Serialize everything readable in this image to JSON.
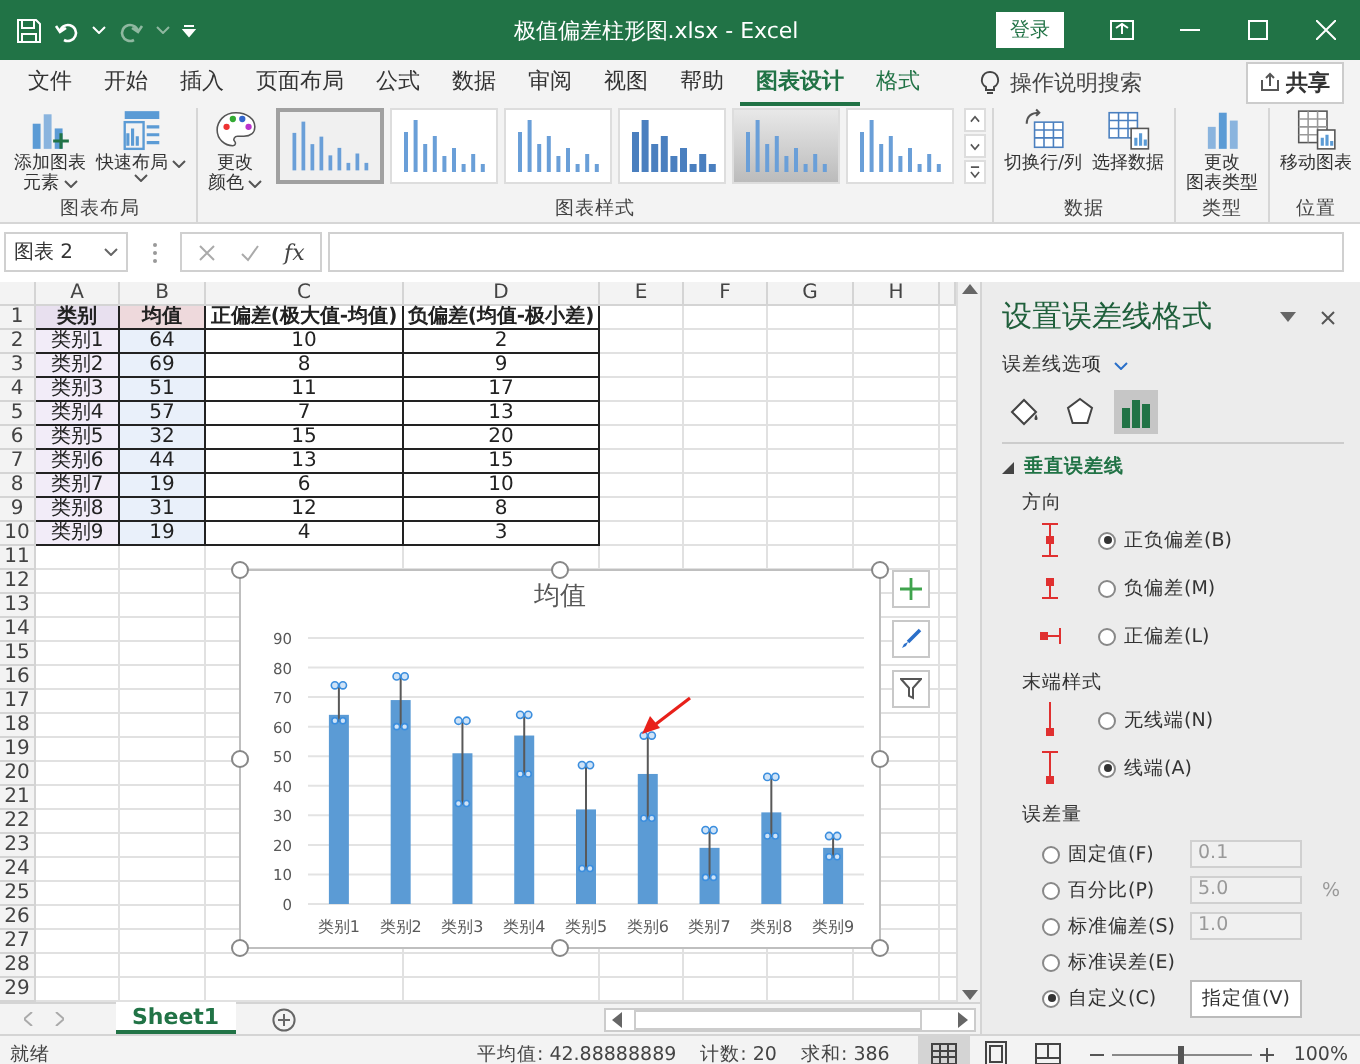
{
  "window": {
    "title": "极值偏差柱形图.xlsx  -  Excel",
    "login": "登录"
  },
  "ribbon": {
    "tabs": [
      {
        "label": "文件",
        "selected": false
      },
      {
        "label": "开始",
        "selected": false
      },
      {
        "label": "插入",
        "selected": false
      },
      {
        "label": "页面布局",
        "selected": false
      },
      {
        "label": "公式",
        "selected": false
      },
      {
        "label": "数据",
        "selected": false
      },
      {
        "label": "审阅",
        "selected": false
      },
      {
        "label": "视图",
        "selected": false
      },
      {
        "label": "帮助",
        "selected": false
      },
      {
        "label": "图表设计",
        "selected": true
      },
      {
        "label": "格式",
        "selected": false
      }
    ],
    "search": "操作说明搜索",
    "share": "共享",
    "groups": [
      {
        "label": "图表布局",
        "buttons": [
          {
            "kind": "add-element",
            "label": [
              "添加图表",
              "元素"
            ],
            "menu": true
          },
          {
            "kind": "quick-layout",
            "label": [
              "快速布局"
            ],
            "menu": true
          }
        ]
      },
      {
        "label": "图表样式",
        "buttons": [
          {
            "kind": "colors",
            "label": [
              "更改",
              "颜色"
            ],
            "menu": true
          }
        ],
        "styles": [
          {
            "selected": true
          },
          {
            "selected": false
          },
          {
            "selected": false
          },
          {
            "selected": false
          },
          {
            "selected": false
          },
          {
            "selected": false
          }
        ]
      },
      {
        "label": "数据",
        "buttons": [
          {
            "kind": "switch",
            "label": [
              "切换行/列"
            ],
            "menu": false
          },
          {
            "kind": "select-data",
            "label": [
              "选择数据"
            ],
            "menu": false
          }
        ]
      },
      {
        "label": "类型",
        "buttons": [
          {
            "kind": "change-type",
            "label": [
              "更改",
              "图表类型"
            ],
            "menu": false
          }
        ]
      },
      {
        "label": "位置",
        "buttons": [
          {
            "kind": "move",
            "label": [
              "移动图表"
            ],
            "menu": false
          }
        ]
      }
    ]
  },
  "formula_bar": {
    "name_box": "图表 2",
    "function_label": "fx"
  },
  "sheet": {
    "column_headers": [
      "A",
      "B",
      "C",
      "D",
      "E",
      "F",
      "G",
      "H"
    ],
    "row_numbers": [
      "1",
      "2",
      "3",
      "4",
      "5",
      "6",
      "7",
      "8",
      "9",
      "10",
      "11",
      "12",
      "13",
      "14",
      "15",
      "16",
      "17",
      "18",
      "19",
      "20",
      "21",
      "22",
      "23",
      "24",
      "25",
      "26",
      "27",
      "28",
      "29"
    ],
    "header": [
      "类别",
      "均值",
      "正偏差(极大值-均值)",
      "负偏差(均值-极小差)"
    ],
    "rows": [
      [
        "类别1",
        "64",
        "10",
        "2"
      ],
      [
        "类别2",
        "69",
        "8",
        "9"
      ],
      [
        "类别3",
        "51",
        "11",
        "17"
      ],
      [
        "类别4",
        "57",
        "7",
        "13"
      ],
      [
        "类别5",
        "32",
        "15",
        "20"
      ],
      [
        "类别6",
        "44",
        "13",
        "15"
      ],
      [
        "类别7",
        "19",
        "6",
        "10"
      ],
      [
        "类别8",
        "31",
        "12",
        "8"
      ],
      [
        "类别9",
        "19",
        "4",
        "3"
      ]
    ],
    "chart": {
      "chart_data": {
        "type": "bar",
        "grid": true,
        "title": "均值",
        "categories": [
          "类别1",
          "类别2",
          "类别3",
          "类别4",
          "类别5",
          "类别6",
          "类别7",
          "类别8",
          "类别9"
        ],
        "values": [
          64,
          69,
          51,
          57,
          32,
          44,
          19,
          31,
          19
        ],
        "ylim": [
          0,
          90
        ],
        "yticks": [
          0,
          10,
          20,
          30,
          40,
          50,
          60,
          70,
          80,
          90
        ]
      }
    }
  },
  "sheet_tabs": [
    {
      "label": "Sheet1",
      "selected": true
    }
  ],
  "pane": {
    "title": "设置误差线格式",
    "options_label": "误差线选项",
    "tabs": [
      {
        "kind": "fill",
        "selected": false
      },
      {
        "kind": "effects",
        "selected": false
      },
      {
        "kind": "options",
        "selected": true
      }
    ],
    "section": {
      "label": "垂直误差线",
      "expanded": true
    },
    "direction": {
      "label": "方向",
      "options": [
        {
          "kind": "both",
          "label": "正负偏差(B)",
          "selected": true
        },
        {
          "kind": "minus",
          "label": "负偏差(M)",
          "selected": false
        },
        {
          "kind": "plus",
          "label": "正偏差(L)",
          "selected": false
        }
      ]
    },
    "end_style": {
      "label": "末端样式",
      "options": [
        {
          "kind": "no-cap",
          "label": "无线端(N)",
          "selected": false
        },
        {
          "kind": "cap",
          "label": "线端(A)",
          "selected": true
        }
      ]
    },
    "amount": {
      "label": "误差量",
      "options": [
        {
          "label": "固定值(F)",
          "selected": false,
          "value": "0.1"
        },
        {
          "label": "百分比(P)",
          "selected": false,
          "value": "5.0",
          "unit": "%"
        },
        {
          "label": "标准偏差(S)",
          "selected": false,
          "value": "1.0"
        },
        {
          "label": "标准误差(E)",
          "selected": false
        },
        {
          "label": "自定义(C)",
          "selected": true,
          "button": "指定值(V)"
        }
      ]
    }
  },
  "status_bar": {
    "status": "就绪",
    "average": "平均值: 42.88888889",
    "count": "计数: 20",
    "sum": "求和: 386",
    "views": [
      {
        "kind": "normal",
        "selected": true
      },
      {
        "kind": "page-layout",
        "selected": false
      },
      {
        "kind": "page-break",
        "selected": false
      }
    ],
    "zoom": {
      "level": 0.5,
      "reading": "100%"
    }
  }
}
